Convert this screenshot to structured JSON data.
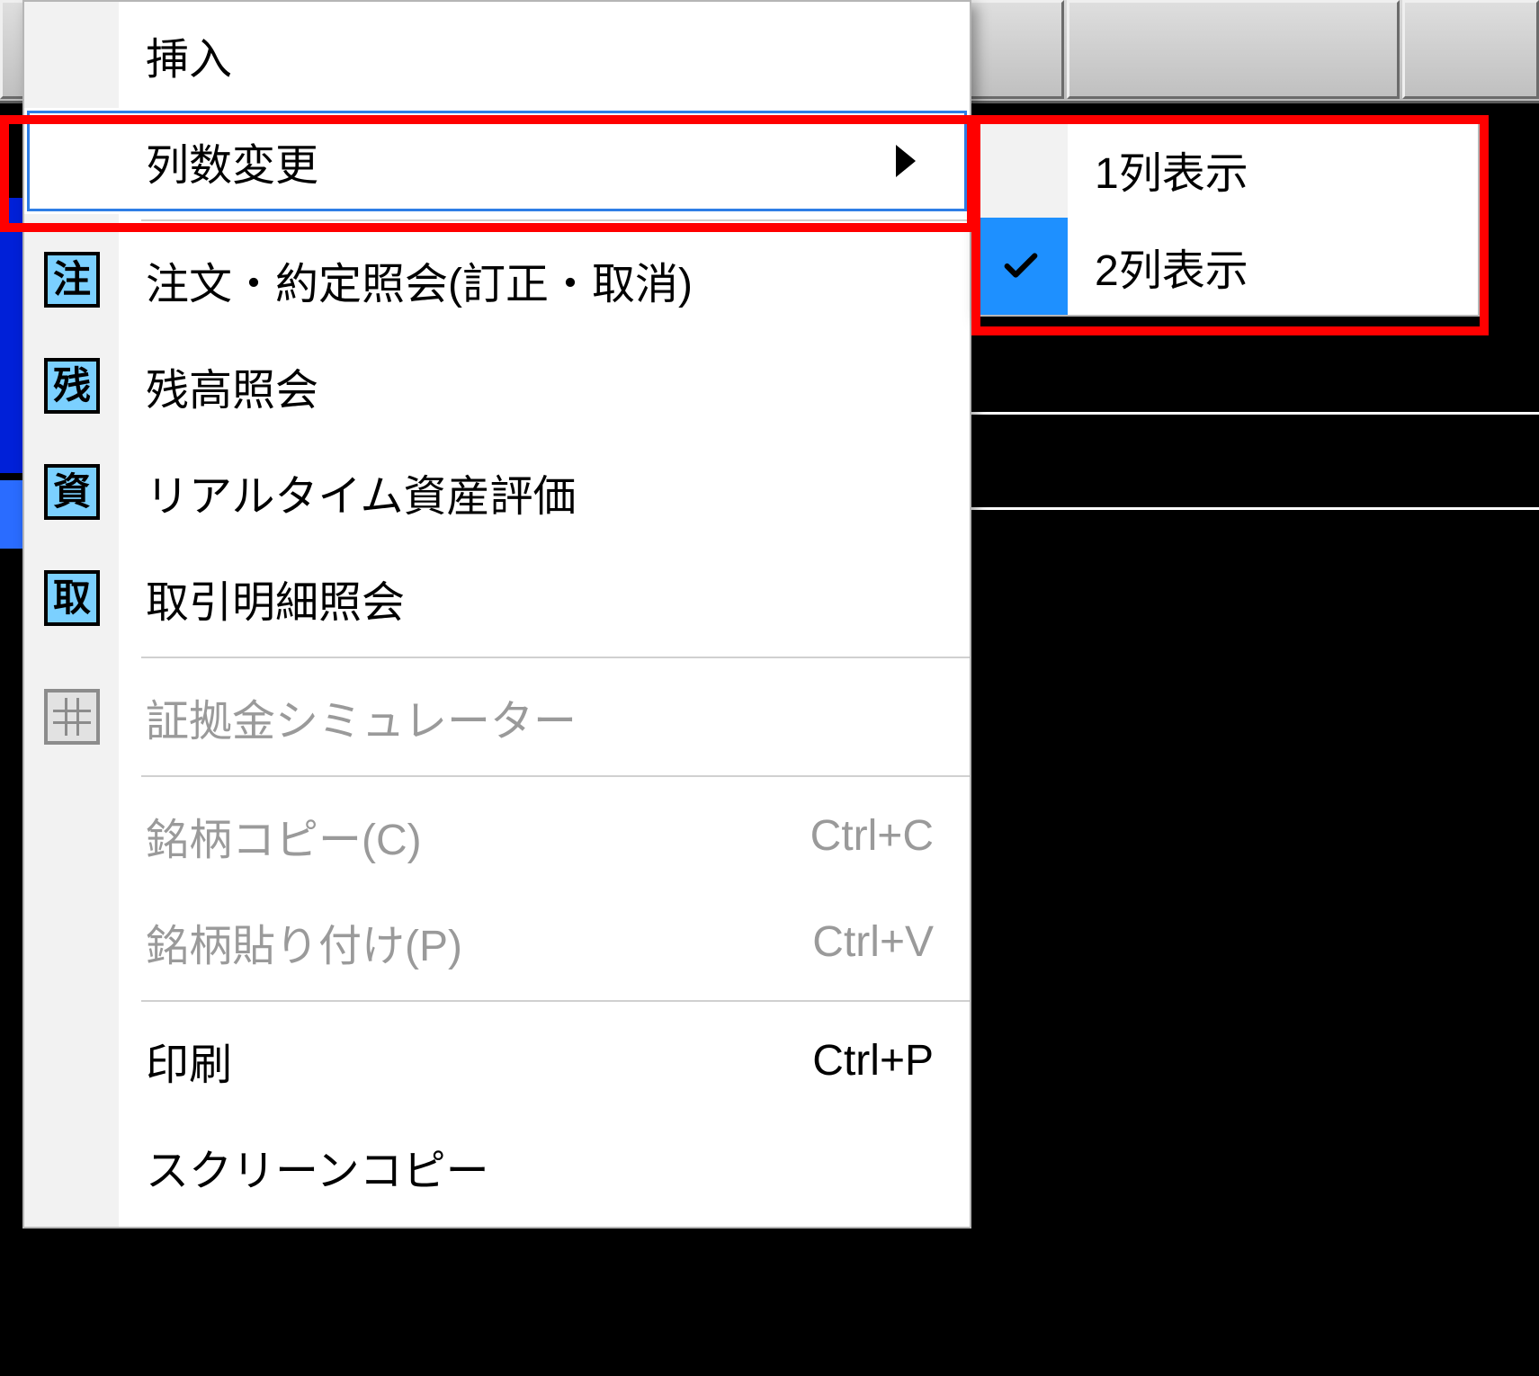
{
  "menu": {
    "items": [
      {
        "label": "挿入",
        "icon": null,
        "enabled": true
      },
      {
        "label": "列数変更",
        "icon": null,
        "enabled": true,
        "hasSubmenu": true,
        "highlighted": true
      },
      {
        "label": "注文・約定照会(訂正・取消)",
        "icon": "注",
        "enabled": true
      },
      {
        "label": "残高照会",
        "icon": "残",
        "enabled": true
      },
      {
        "label": "リアルタイム資産評価",
        "icon": "資",
        "enabled": true
      },
      {
        "label": "取引明細照会",
        "icon": "取",
        "enabled": true
      },
      {
        "label": "証拠金シミュレーター",
        "icon": "grid",
        "enabled": false
      },
      {
        "label": "銘柄コピー(C)",
        "shortcut": "Ctrl+C",
        "enabled": false
      },
      {
        "label": "銘柄貼り付け(P)",
        "shortcut": "Ctrl+V",
        "enabled": false
      },
      {
        "label": "印刷",
        "shortcut": "Ctrl+P",
        "enabled": true
      },
      {
        "label": "スクリーンコピー",
        "enabled": true
      }
    ]
  },
  "submenu": {
    "items": [
      {
        "label": "1列表示",
        "checked": false
      },
      {
        "label": "2列表示",
        "checked": true
      }
    ]
  }
}
